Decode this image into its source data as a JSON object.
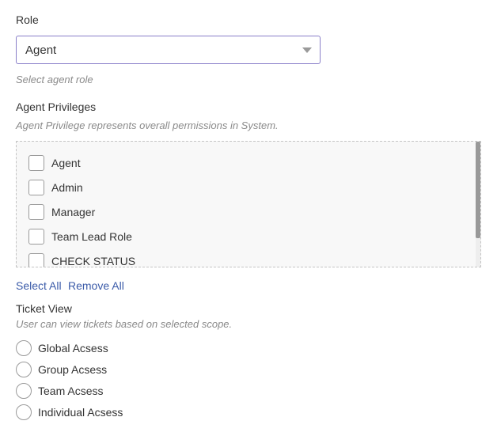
{
  "role": {
    "label": "Role",
    "selected": "Agent",
    "hint": "Select agent role"
  },
  "privileges": {
    "label": "Agent Privileges",
    "hint": "Agent Privilege represents overall permissions in System.",
    "items": [
      {
        "label": "Agent",
        "checked": false
      },
      {
        "label": "Admin",
        "checked": false
      },
      {
        "label": "Manager",
        "checked": false
      },
      {
        "label": "Team Lead Role",
        "checked": false
      },
      {
        "label": "CHECK STATUS",
        "checked": false
      }
    ],
    "select_all": "Select All",
    "remove_all": "Remove All"
  },
  "ticket_view": {
    "label": "Ticket View",
    "hint": "User can view tickets based on selected scope.",
    "options": [
      {
        "label": "Global Acsess",
        "selected": false
      },
      {
        "label": "Group Acsess",
        "selected": false
      },
      {
        "label": "Team Acsess",
        "selected": false
      },
      {
        "label": "Individual Acsess",
        "selected": false
      }
    ]
  },
  "colors": {
    "select_border": "#8a7fc9",
    "link": "#3b5ba9",
    "hint_text": "#8a8a8a"
  }
}
